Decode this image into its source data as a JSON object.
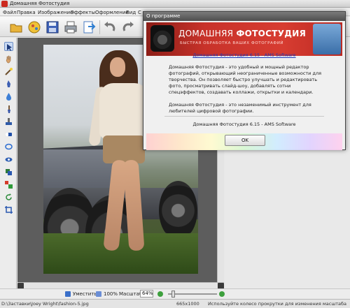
{
  "window": {
    "title": "Домашняя Фотостудия"
  },
  "menu": [
    "Файл",
    "Правка",
    "Изображение",
    "Эффекты",
    "Оформление",
    "Вид",
    "С"
  ],
  "toolbar": {
    "icons": [
      "open-folder-icon",
      "open-image-icon",
      "save-icon",
      "print-icon",
      "export-icon",
      "undo-icon",
      "redo-icon"
    ]
  },
  "tools": [
    "pointer-icon",
    "hand-icon",
    "magic-wand-icon",
    "pen-icon",
    "drop-icon",
    "brush-icon",
    "stamp-icon",
    "eraser-icon",
    "lasso-icon",
    "eye-icon",
    "layers-icon",
    "color-picker-icon",
    "rotate-icon",
    "crop-icon"
  ],
  "bottom": {
    "fit_label": "Уместить",
    "zoom100_label": "100%",
    "scale_label": "Масштаб:",
    "scale_value": "64%"
  },
  "status": {
    "path": "D:\\Заставки\\Joey Wright\\fashion-5.jpg",
    "dimensions": "665x1000",
    "hint": "Используйте колесо прокрутки для изменения масштаба"
  },
  "about": {
    "title": "О программе",
    "banner_title_light": "ДОМАШНЯЯ ",
    "banner_title_bold": "ФОТОСТУДИЯ",
    "banner_subtitle": "БЫСТРАЯ ОБРАБОТКА ВАШИХ ФОТОГРАФИЙ",
    "link": "Домашняя Фотостудия 6.15 - AMS Software",
    "para1": "Домашняя Фотостудия - это удобный и мощный редактор фотографий, открывающий неограниченные возможности для творчества. Он позволяет быстро улучшать и редактировать фото, просматривать слайд-шоу, добавлять сотни спецэффектов, создавать коллажи, открытки и календари.",
    "para2": "Домашняя Фотостудия - это незаменимый инструмент для любителей цифровой фотографии.",
    "version": "Домашняя Фотостудия 6.15 - AMS Software",
    "ok": "OK"
  }
}
